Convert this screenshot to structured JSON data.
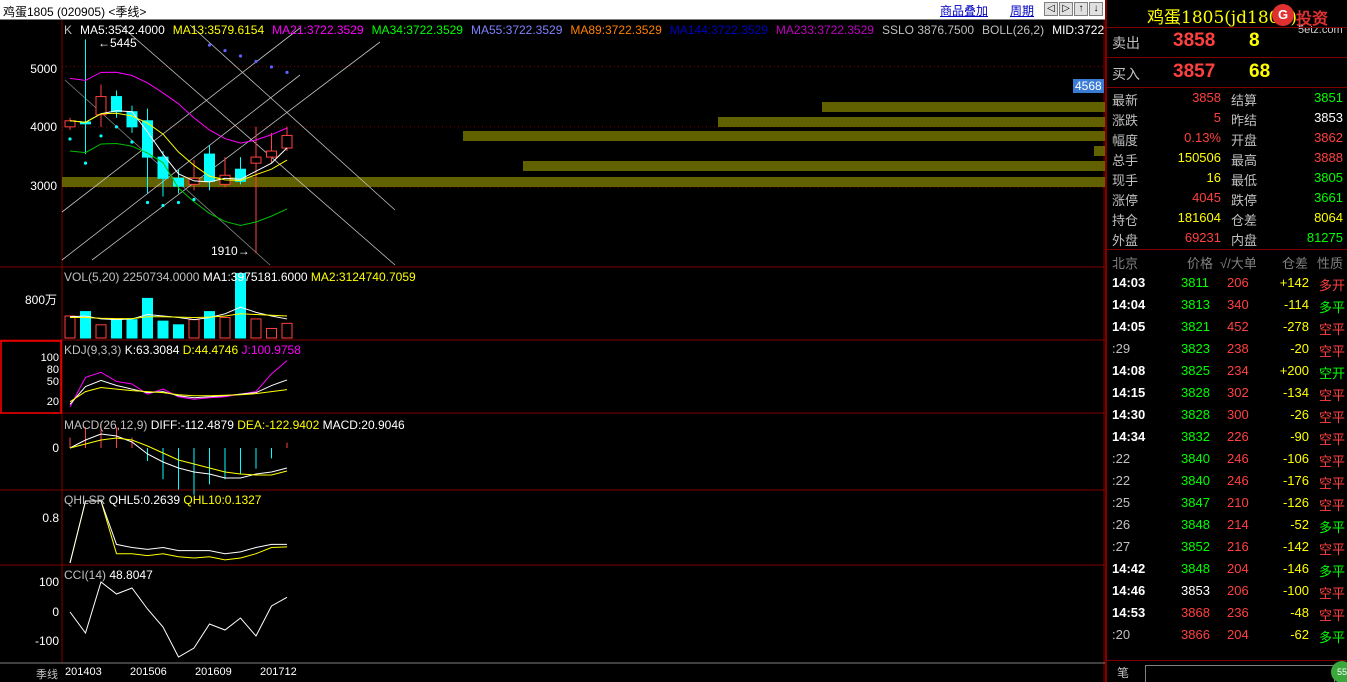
{
  "topbar": {
    "title": "鸡蛋1805 (020905) <季线>",
    "overlay_btn": "商品叠加",
    "period_btn": "周期",
    "nav_icons": [
      "chevron-left-icon",
      "chevron-right-icon",
      "arrow-up-icon",
      "arrow-down-icon"
    ]
  },
  "chart": {
    "ma_labels": [
      {
        "text": "K",
        "color": "#c0c0c0"
      },
      {
        "text": "MA5:3542.4000",
        "color": "#ffffff"
      },
      {
        "text": "MA13:3579.6154",
        "color": "#ffff00"
      },
      {
        "text": "MA21:3722.3529",
        "color": "#ff00ff"
      },
      {
        "text": "MA34:3722.3529",
        "color": "#00ff00"
      },
      {
        "text": "MA55:3722.3529",
        "color": "#8080ff"
      },
      {
        "text": "MA89:3722.3529",
        "color": "#ff8000"
      },
      {
        "text": "MA144:3722.3529",
        "color": "#0000c0"
      },
      {
        "text": "MA233:3722.3529",
        "color": "#c000c0"
      },
      {
        "text": "SSLO 3876.7500",
        "color": "#c0c0c0"
      },
      {
        "text": "BOLL(26,2)",
        "color": "#c0c0c0"
      },
      {
        "text": "MID:3722",
        "color": "#ffffff"
      }
    ],
    "price_axis": [
      "5000",
      "4000",
      "3000"
    ],
    "price_range": [
      1800,
      5600
    ],
    "last_price_tag": "4568",
    "high_label": "←5445",
    "low_label": "1910→",
    "candles": [
      {
        "o": 4000,
        "h": 4150,
        "l": 3950,
        "c": 4100
      },
      {
        "o": 4080,
        "h": 5445,
        "l": 3550,
        "c": 4050
      },
      {
        "o": 4200,
        "h": 4700,
        "l": 4000,
        "c": 4500
      },
      {
        "o": 4500,
        "h": 4600,
        "l": 4150,
        "c": 4250
      },
      {
        "o": 4250,
        "h": 4350,
        "l": 3900,
        "c": 4000
      },
      {
        "o": 4100,
        "h": 4300,
        "l": 2900,
        "c": 3500
      },
      {
        "o": 3500,
        "h": 3600,
        "l": 2850,
        "c": 3150
      },
      {
        "o": 3150,
        "h": 3300,
        "l": 2900,
        "c": 3020
      },
      {
        "o": 3050,
        "h": 3450,
        "l": 2950,
        "c": 3150
      },
      {
        "o": 3550,
        "h": 3700,
        "l": 2950,
        "c": 3100
      },
      {
        "o": 3050,
        "h": 3500,
        "l": 3000,
        "c": 3200
      },
      {
        "o": 3300,
        "h": 3500,
        "l": 3050,
        "c": 3100
      },
      {
        "o": 3400,
        "h": 4000,
        "l": 1910,
        "c": 3500
      },
      {
        "o": 3500,
        "h": 3900,
        "l": 3400,
        "c": 3600
      },
      {
        "o": 3650,
        "h": 4000,
        "l": 3600,
        "c": 3858
      }
    ],
    "volume_panel": {
      "label": "VOL(5,20) 2250734.0000",
      "ma1": "MA1:3975181.6000",
      "ma2": "MA2:3124740.7059",
      "axis": "800万",
      "volumes": [
        300,
        360,
        180,
        250,
        250,
        540,
        230,
        180,
        250,
        360,
        280,
        880,
        260,
        130,
        200
      ]
    },
    "kdj_panel": {
      "label": "KDJ(9,3,3)",
      "k": "K:63.3084",
      "d": "D:44.4746",
      "j": "J:100.9758",
      "axis": [
        "100",
        "80",
        "50",
        "20"
      ]
    },
    "macd_panel": {
      "label": "MACD(26,12,9)",
      "diff": "DIFF:-112.4879",
      "dea": "DEA:-122.9402",
      "macd": "MACD:20.9046",
      "axis": [
        "0"
      ]
    },
    "qhlsr_panel": {
      "label": "QHLSR",
      "qhl5": "QHL5:0.2639",
      "qhl10": "QHL10:0.1327",
      "axis": [
        "0.8"
      ]
    },
    "cci_panel": {
      "label": "CCI(14)",
      "value": "48.8047",
      "axis": [
        "100",
        "0",
        "-100"
      ],
      "values": [
        0,
        -70,
        100,
        60,
        80,
        10,
        -50,
        -150,
        -120,
        -40,
        -60,
        -20,
        -80,
        20,
        48.8
      ]
    },
    "period_label": "季线",
    "dates": [
      "201403",
      "201506",
      "201609",
      "201712"
    ]
  },
  "quote": {
    "name": "鸡蛋1805(jd1805)",
    "logo_brand": "投资",
    "logo_site": "5etz.com",
    "sell_label": "卖出",
    "sell_price": "3858",
    "sell_vol": "8",
    "buy_label": "买入",
    "buy_price": "3857",
    "buy_vol": "68",
    "stats": [
      {
        "l1": "最新",
        "v1": "3858",
        "c1": "#ff4040",
        "l2": "结算",
        "v2": "3851",
        "c2": "#00ff00"
      },
      {
        "l1": "涨跌",
        "v1": "5",
        "c1": "#ff4040",
        "l2": "昨结",
        "v2": "3853",
        "c2": "#ffffff"
      },
      {
        "l1": "幅度",
        "v1": "0.13%",
        "c1": "#ff4040",
        "l2": "开盘",
        "v2": "3862",
        "c2": "#ff4040"
      },
      {
        "l1": "总手",
        "v1": "150506",
        "c1": "#ffff00",
        "l2": "最高",
        "v2": "3888",
        "c2": "#ff4040"
      },
      {
        "l1": "现手",
        "v1": "16",
        "c1": "#ffff00",
        "l2": "最低",
        "v2": "3805",
        "c2": "#00ff00"
      },
      {
        "l1": "涨停",
        "v1": "4045",
        "c1": "#ff4040",
        "l2": "跌停",
        "v2": "3661",
        "c2": "#00ff00"
      },
      {
        "l1": "持仓",
        "v1": "181604",
        "c1": "#ffff00",
        "l2": "仓差",
        "v2": "8064",
        "c2": "#ffff00"
      },
      {
        "l1": "外盘",
        "v1": "69231",
        "c1": "#ff4040",
        "l2": "内盘",
        "v2": "81275",
        "c2": "#00ff00"
      }
    ],
    "ticks_header": [
      "北京",
      "价格",
      "√/大单",
      "仓差",
      "性质"
    ],
    "ticks": [
      {
        "t": "14:03",
        "p": "3811",
        "v": "206",
        "d": "+142",
        "k": "多开",
        "tc": "#ffffff",
        "dc": "#ffff00",
        "kc": "#ff4040"
      },
      {
        "t": "14:04",
        "p": "3813",
        "v": "340",
        "d": "-114",
        "k": "多平",
        "tc": "#ffffff",
        "dc": "#ffff00",
        "kc": "#00ff00"
      },
      {
        "t": "14:05",
        "p": "3821",
        "v": "452",
        "d": "-278",
        "k": "空平",
        "tc": "#ffffff",
        "dc": "#ffff00",
        "kc": "#ff4040"
      },
      {
        "t": ":29",
        "p": "3823",
        "v": "238",
        "d": "-20",
        "k": "空平",
        "tc": "#c0c0c0",
        "dc": "#ffff00",
        "kc": "#ff4040"
      },
      {
        "t": "14:08",
        "p": "3825",
        "v": "234",
        "d": "+200",
        "k": "空开",
        "tc": "#ffffff",
        "dc": "#ffff00",
        "kc": "#00ff00"
      },
      {
        "t": "14:15",
        "p": "3828",
        "v": "302",
        "d": "-134",
        "k": "空平",
        "tc": "#ffffff",
        "dc": "#ffff00",
        "kc": "#ff4040"
      },
      {
        "t": "14:30",
        "p": "3828",
        "v": "300",
        "d": "-26",
        "k": "空平",
        "tc": "#ffffff",
        "dc": "#ffff00",
        "kc": "#ff4040"
      },
      {
        "t": "14:34",
        "p": "3832",
        "v": "226",
        "d": "-90",
        "k": "空平",
        "tc": "#ffffff",
        "dc": "#ffff00",
        "kc": "#ff4040"
      },
      {
        "t": ":22",
        "p": "3840",
        "v": "246",
        "d": "-106",
        "k": "空平",
        "tc": "#c0c0c0",
        "dc": "#ffff00",
        "kc": "#ff4040"
      },
      {
        "t": ":22",
        "p": "3840",
        "v": "246",
        "d": "-176",
        "k": "空平",
        "tc": "#c0c0c0",
        "dc": "#ffff00",
        "kc": "#ff4040"
      },
      {
        "t": ":25",
        "p": "3847",
        "v": "210",
        "d": "-126",
        "k": "空平",
        "tc": "#c0c0c0",
        "dc": "#ffff00",
        "kc": "#ff4040"
      },
      {
        "t": ":26",
        "p": "3848",
        "v": "214",
        "d": "-52",
        "k": "多平",
        "tc": "#c0c0c0",
        "dc": "#ffff00",
        "kc": "#00ff00"
      },
      {
        "t": ":27",
        "p": "3852",
        "v": "216",
        "d": "-142",
        "k": "空平",
        "tc": "#c0c0c0",
        "dc": "#ffff00",
        "kc": "#ff4040"
      },
      {
        "t": "14:42",
        "p": "3848",
        "v": "204",
        "d": "-146",
        "k": "多平",
        "tc": "#ffffff",
        "dc": "#ffff00",
        "kc": "#00ff00"
      },
      {
        "t": "14:46",
        "p": "3853",
        "v": "206",
        "d": "-100",
        "k": "空平",
        "tc": "#ffffff",
        "dc": "#ffff00",
        "kc": "#ff4040"
      },
      {
        "t": "14:53",
        "p": "3868",
        "v": "236",
        "d": "-48",
        "k": "空平",
        "tc": "#ffffff",
        "dc": "#ffff00",
        "kc": "#ff4040"
      },
      {
        "t": ":20",
        "p": "3866",
        "v": "204",
        "d": "-62",
        "k": "多平",
        "tc": "#c0c0c0",
        "dc": "#ffff00",
        "kc": "#00ff00"
      }
    ],
    "bottom_tab": "笔",
    "bottom_badge": "55"
  }
}
